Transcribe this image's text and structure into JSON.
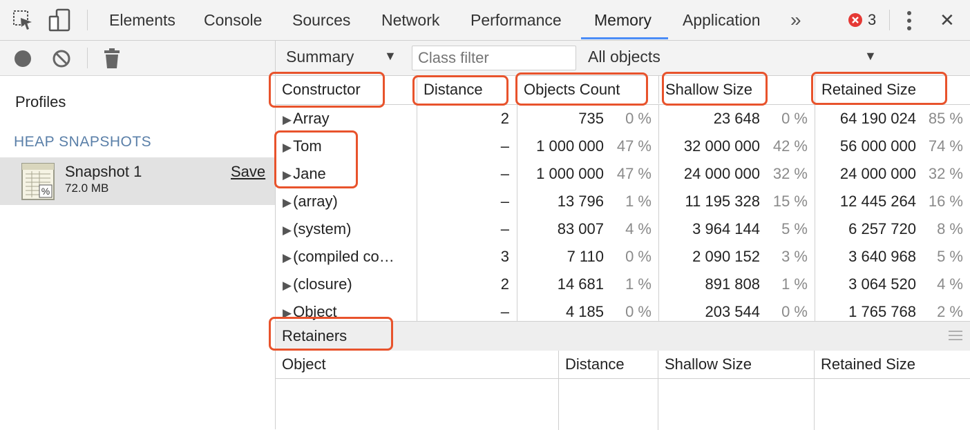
{
  "toolbar": {
    "tabs": [
      "Elements",
      "Console",
      "Sources",
      "Network",
      "Performance",
      "Memory",
      "Application"
    ],
    "active_tab": "Memory",
    "more_label": "»",
    "error_count": "3",
    "close_label": "✕"
  },
  "left": {
    "profiles_label": "Profiles",
    "section_label": "HEAP SNAPSHOTS",
    "snapshot": {
      "name": "Snapshot 1",
      "size": "72.0 MB",
      "save_label": "Save"
    }
  },
  "filters": {
    "view": "Summary",
    "class_filter_placeholder": "Class filter",
    "objects": "All objects"
  },
  "table": {
    "headers": [
      "Constructor",
      "Distance",
      "Objects Count",
      "Shallow Size",
      "Retained Size"
    ],
    "rows": [
      {
        "name": "Array",
        "distance": "2",
        "count": "735",
        "count_pct": "0 %",
        "shallow": "23 648",
        "shallow_pct": "0 %",
        "retained": "64 190 024",
        "retained_pct": "85 %"
      },
      {
        "name": "Tom",
        "distance": "–",
        "count": "1 000 000",
        "count_pct": "47 %",
        "shallow": "32 000 000",
        "shallow_pct": "42 %",
        "retained": "56 000 000",
        "retained_pct": "74 %"
      },
      {
        "name": "Jane",
        "distance": "–",
        "count": "1 000 000",
        "count_pct": "47 %",
        "shallow": "24 000 000",
        "shallow_pct": "32 %",
        "retained": "24 000 000",
        "retained_pct": "32 %"
      },
      {
        "name": "(array)",
        "distance": "–",
        "count": "13 796",
        "count_pct": "1 %",
        "shallow": "11 195 328",
        "shallow_pct": "15 %",
        "retained": "12 445 264",
        "retained_pct": "16 %"
      },
      {
        "name": "(system)",
        "distance": "–",
        "count": "83 007",
        "count_pct": "4 %",
        "shallow": "3 964 144",
        "shallow_pct": "5 %",
        "retained": "6 257 720",
        "retained_pct": "8 %"
      },
      {
        "name": "(compiled co…",
        "distance": "3",
        "count": "7 110",
        "count_pct": "0 %",
        "shallow": "2 090 152",
        "shallow_pct": "3 %",
        "retained": "3 640 968",
        "retained_pct": "5 %"
      },
      {
        "name": "(closure)",
        "distance": "2",
        "count": "14 681",
        "count_pct": "1 %",
        "shallow": "891 808",
        "shallow_pct": "1 %",
        "retained": "3 064 520",
        "retained_pct": "4 %"
      },
      {
        "name": "Object",
        "distance": "–",
        "count": "4 185",
        "count_pct": "0 %",
        "shallow": "203 544",
        "shallow_pct": "0 %",
        "retained": "1 765 768",
        "retained_pct": "2 %"
      }
    ]
  },
  "retainers": {
    "title": "Retainers",
    "headers": [
      "Object",
      "Distance",
      "Shallow Size",
      "Retained Size"
    ]
  },
  "colors": {
    "highlight": "#e8532c",
    "accent": "#4a8cf7",
    "error": "#e53935"
  }
}
